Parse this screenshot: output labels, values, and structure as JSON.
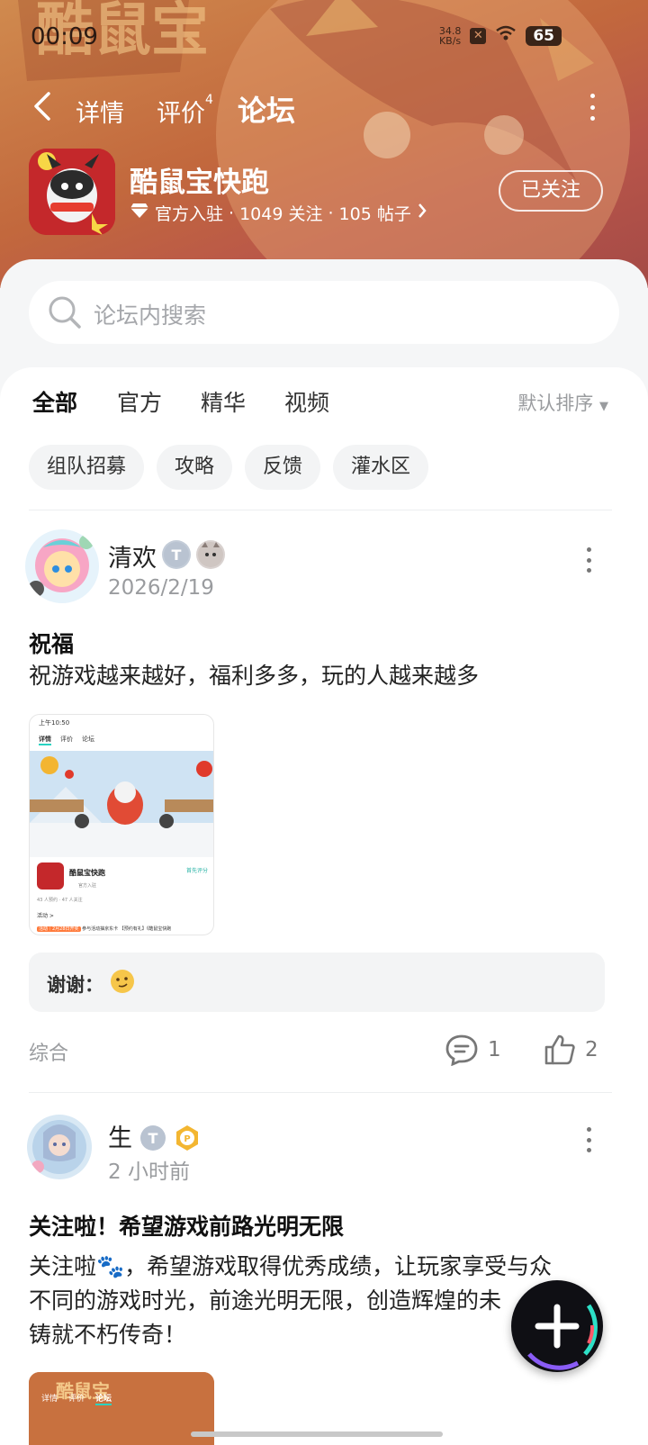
{
  "status_bar": {
    "time": "00:09",
    "speed_value": "34.8",
    "speed_unit": "KB/s",
    "battery": "65"
  },
  "nav": {
    "tabs": [
      {
        "label": "详情"
      },
      {
        "label": "评价",
        "badge": "4"
      },
      {
        "label": "论坛"
      }
    ],
    "active_tab": "论坛"
  },
  "game": {
    "name": "酷鼠宝快跑",
    "official": "官方入驻",
    "followers": "1049 关注",
    "posts": "105 帖子",
    "follow_button": "已关注"
  },
  "search": {
    "placeholder": "论坛内搜索"
  },
  "filter_tabs": [
    "全部",
    "官方",
    "精华",
    "视频"
  ],
  "sort_label": "默认排序",
  "chips": [
    "组队招募",
    "攻略",
    "反馈",
    "灌水区"
  ],
  "posts": [
    {
      "author": "清欢",
      "time": "2026/2/19",
      "title": "祝福",
      "body": "祝游戏越来越好，福利多多，玩的人越来越多",
      "reply_author": "谢谢：",
      "tag": "综合",
      "comments": "1",
      "likes": "2",
      "thumb": {
        "status_time": "上午10:50",
        "tabs": [
          "详情",
          "评价",
          "论坛"
        ],
        "game_name": "酷鼠宝快跑",
        "rate_label": "首先评分",
        "official": "官方入驻",
        "stats": "43 人预约  · 47 人关注",
        "activity": "活动 >",
        "banner_tag": "活动｜2月28日开奖",
        "banner_text": "参与活动抽京东卡 【预约有礼】《酷鼠宝快跑"
      }
    },
    {
      "author": "生",
      "time": "2 小时前",
      "title": "关注啦！希望游戏前路光明无限",
      "body_line1": "关注啦",
      "body_line1_rest": "，希望游戏取得优秀成绩，让玩家享受与众",
      "body_line2": "不同的游戏时光，前途光明无限，创造辉煌的未",
      "body_line3": "铸就不朽传奇！",
      "thumb_tabs": [
        "详情",
        "评价",
        "论坛"
      ]
    }
  ],
  "colors": {
    "accent": "#29d3c1",
    "banner": "#c2683d",
    "text_muted": "#9a9c9f"
  },
  "icons": [
    "back-arrow-icon",
    "more-vertical-icon",
    "diamond-icon",
    "chevron-right-icon",
    "search-icon",
    "caret-down-icon",
    "comment-icon",
    "thumbs-up-icon",
    "plus-icon"
  ]
}
